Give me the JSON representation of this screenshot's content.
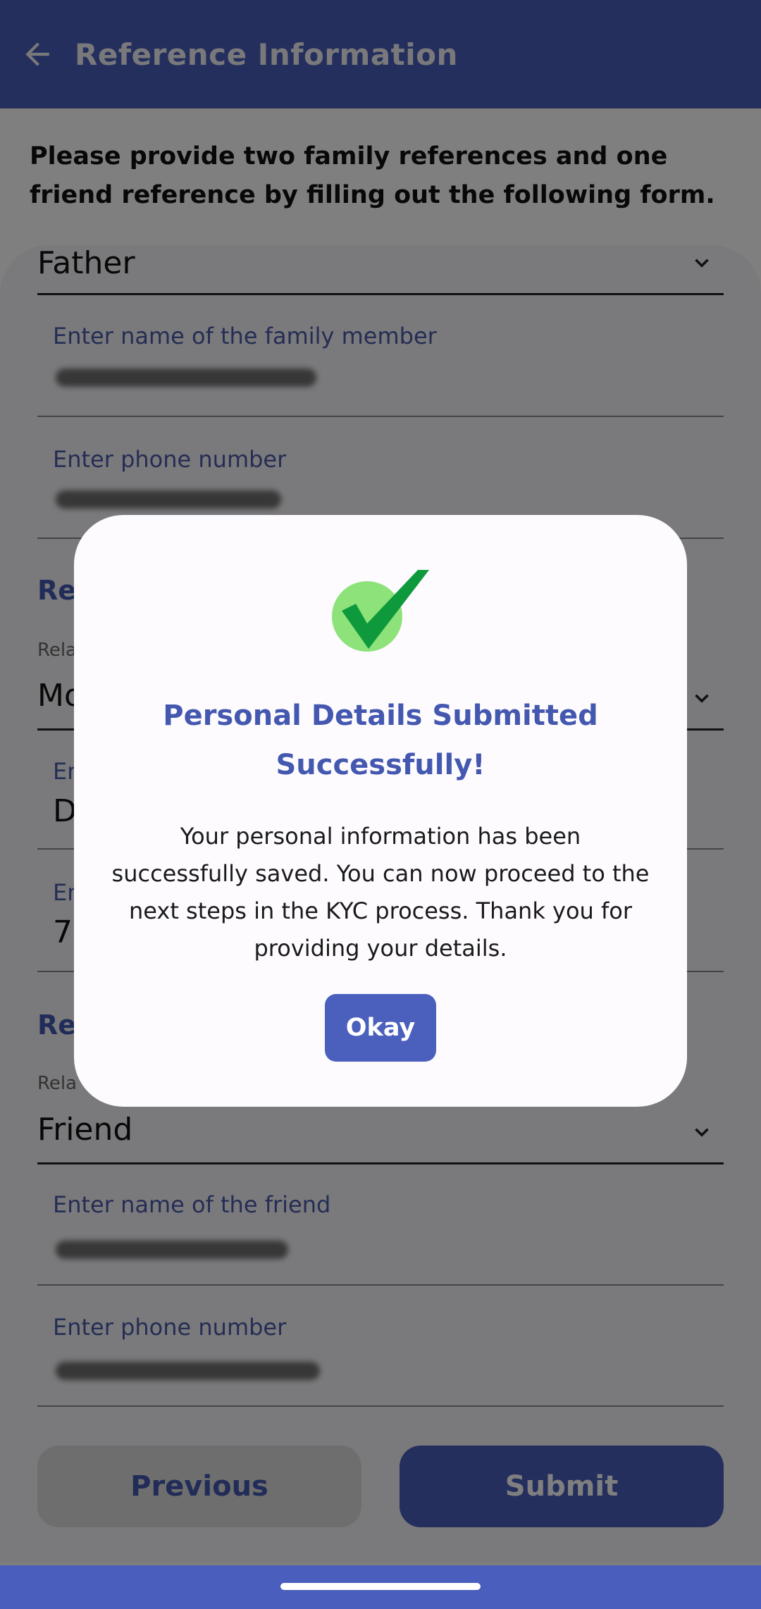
{
  "app_bar": {
    "title": "Reference Information",
    "back_icon": "arrow-left-icon"
  },
  "intro_text": "Please provide two family references and one friend reference by filling out the following form.",
  "family_reference_1": {
    "relation_value": "Father",
    "name_label": "Enter name of the family member",
    "phone_label": "Enter phone number"
  },
  "family_reference_2": {
    "section_title_visible": "Re",
    "relation_label_visible": "Rela",
    "relation_value_visible": "Mo",
    "name_label_visible": "En",
    "name_value_visible": "D",
    "phone_label_visible": "En",
    "phone_value_visible": "7"
  },
  "friend_reference": {
    "section_title_visible": "Re",
    "relation_label_visible": "Rela",
    "relation_value": "Friend",
    "name_label": "Enter name of the friend",
    "phone_label": "Enter phone number"
  },
  "buttons": {
    "previous": "Previous",
    "submit": "Submit"
  },
  "dialog": {
    "title": "Personal Details Submitted Successfully!",
    "message": "Your personal information has been successfully saved. You can now proceed to the next steps in the KYC process. Thank you for providing your details.",
    "ok_label": "Okay",
    "icon": "checkmark-success-icon"
  },
  "colors": {
    "primary": "#4b5fbd",
    "check_green": "#0e9a3c",
    "check_circle": "#8ee27a"
  }
}
